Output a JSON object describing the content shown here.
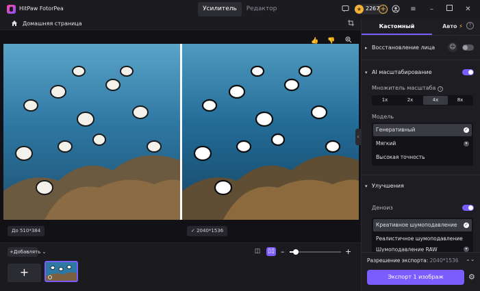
{
  "app": {
    "title": "HitPaw FotorPea"
  },
  "tabs": [
    {
      "label": "Усилитель",
      "active": true
    },
    {
      "label": "Редактор",
      "active": false
    }
  ],
  "header": {
    "credits": "2267",
    "icons": [
      "feedback-icon",
      "coin-icon",
      "add-credits-icon",
      "user-icon",
      "menu-icon",
      "minimize-icon",
      "maximize-icon",
      "close-icon"
    ]
  },
  "breadcrumb": {
    "home": "Домашняя страница"
  },
  "canvas": {
    "before_size": "До 510*384",
    "after_size": "2040*1536"
  },
  "bottom": {
    "add_label": "Добавлять",
    "zoom_level": 0.12
  },
  "panel": {
    "tabs": [
      {
        "label": "Кастомный",
        "active": true
      },
      {
        "label": "Авто",
        "active": false
      }
    ],
    "face_restore": {
      "title": "Восстановление лица",
      "enabled": false
    },
    "ai_upscale": {
      "title": "AI масштабирование",
      "enabled": true,
      "scale_label": "Множитель масштаба",
      "scales": [
        "1x",
        "2x",
        "4x",
        "8x"
      ],
      "selected_scale": "4x",
      "model_label": "Модель",
      "models": [
        "Генеративный",
        "Мягкий",
        "Высокая точность"
      ],
      "selected_model": "Генеративный"
    },
    "improvements": {
      "title": "Улучшения",
      "denoise_label": "Деноиз",
      "denoise_enabled": true,
      "denoise_options": [
        "Креативное шумоподавление",
        "Реалистичное шумоподавление",
        "Шумоподавление RAW"
      ],
      "selected_denoise": "Креативное шумоподавление"
    },
    "export": {
      "label": "Разрешение экспорта:",
      "value": "2040*1536",
      "button": "Экспорт 1 изображ"
    }
  },
  "colors": {
    "accent": "#7b5cff",
    "background": "#17171b",
    "panel": "#1d1d22"
  }
}
